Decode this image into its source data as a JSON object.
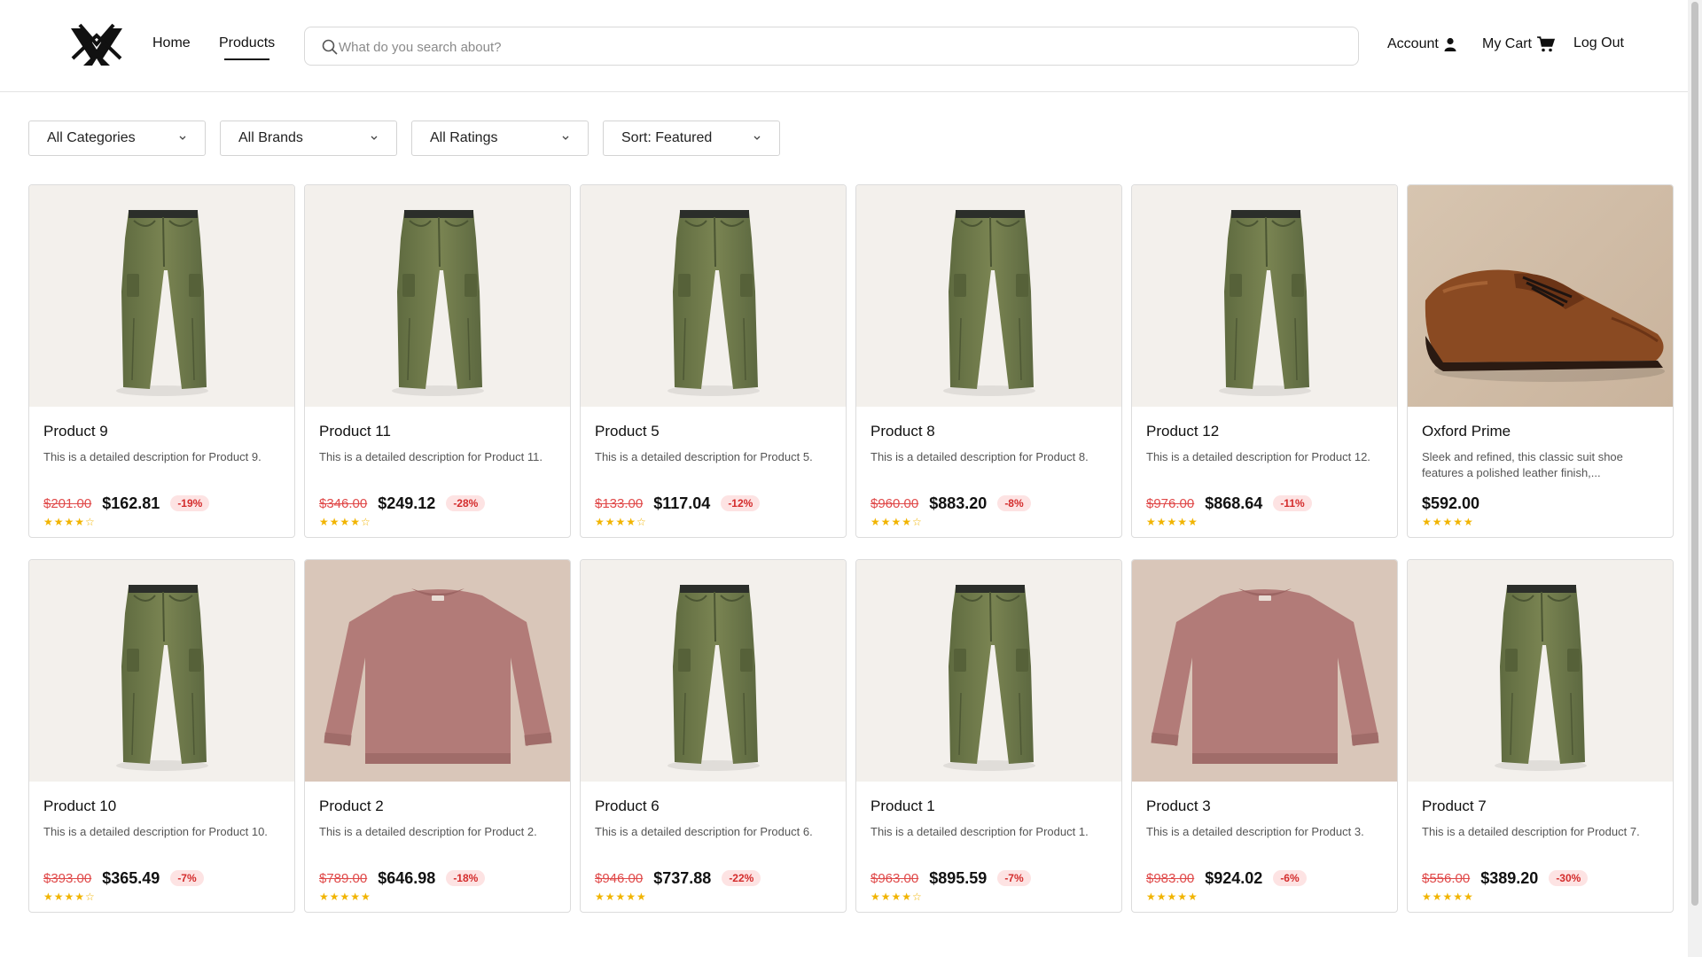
{
  "header": {
    "nav": {
      "home": "Home",
      "products": "Products"
    },
    "search_placeholder": "What do you search about?",
    "account": "Account",
    "cart": "My Cart",
    "logout": "Log Out"
  },
  "filters": {
    "categories": "All Categories",
    "brands": "All Brands",
    "ratings": "All Ratings",
    "sort": "Sort: Featured"
  },
  "colors": {
    "star": "#f1b400",
    "sale": "#e04a4a",
    "badge_bg": "#fde3e3"
  },
  "products": [
    {
      "name": "Product 9",
      "description": "This is a detailed description for Product 9.",
      "old_price": "$201.00",
      "price": "$162.81",
      "discount": "-19%",
      "stars": "★★★★☆",
      "rating": 4,
      "image": "olive-pants"
    },
    {
      "name": "Product 11",
      "description": "This is a detailed description for Product 11.",
      "old_price": "$346.00",
      "price": "$249.12",
      "discount": "-28%",
      "stars": "★★★★☆",
      "rating": 4,
      "image": "olive-pants"
    },
    {
      "name": "Product 5",
      "description": "This is a detailed description for Product 5.",
      "old_price": "$133.00",
      "price": "$117.04",
      "discount": "-12%",
      "stars": "★★★★☆",
      "rating": 4,
      "image": "olive-pants"
    },
    {
      "name": "Product 8",
      "description": "This is a detailed description for Product 8.",
      "old_price": "$960.00",
      "price": "$883.20",
      "discount": "-8%",
      "stars": "★★★★☆",
      "rating": 4,
      "image": "olive-pants"
    },
    {
      "name": "Product 12",
      "description": "This is a detailed description for Product 12.",
      "old_price": "$976.00",
      "price": "$868.64",
      "discount": "-11%",
      "stars": "★★★★★",
      "rating": 5,
      "image": "olive-pants"
    },
    {
      "name": "Oxford Prime",
      "description": "Sleek and refined, this classic suit shoe features a polished leather finish,...",
      "old_price": "",
      "price": "$592.00",
      "discount": "",
      "stars": "★★★★★",
      "rating": 5,
      "image": "brown-oxford-shoe"
    },
    {
      "name": "Product 10",
      "description": "This is a detailed description for Product 10.",
      "old_price": "$393.00",
      "price": "$365.49",
      "discount": "-7%",
      "stars": "★★★★☆",
      "rating": 4,
      "image": "olive-pants"
    },
    {
      "name": "Product 2",
      "description": "This is a detailed description for Product 2.",
      "old_price": "$789.00",
      "price": "$646.98",
      "discount": "-18%",
      "stars": "★★★★★",
      "rating": 5,
      "image": "rose-sweatshirt"
    },
    {
      "name": "Product 6",
      "description": "This is a detailed description for Product 6.",
      "old_price": "$946.00",
      "price": "$737.88",
      "discount": "-22%",
      "stars": "★★★★★",
      "rating": 5,
      "image": "olive-pants"
    },
    {
      "name": "Product 1",
      "description": "This is a detailed description for Product 1.",
      "old_price": "$963.00",
      "price": "$895.59",
      "discount": "-7%",
      "stars": "★★★★☆",
      "rating": 4,
      "image": "olive-pants"
    },
    {
      "name": "Product 3",
      "description": "This is a detailed description for Product 3.",
      "old_price": "$983.00",
      "price": "$924.02",
      "discount": "-6%",
      "stars": "★★★★★",
      "rating": 5,
      "image": "rose-sweatshirt"
    },
    {
      "name": "Product 7",
      "description": "This is a detailed description for Product 7.",
      "old_price": "$556.00",
      "price": "$389.20",
      "discount": "-30%",
      "stars": "★★★★★",
      "rating": 5,
      "image": "olive-pants"
    }
  ]
}
